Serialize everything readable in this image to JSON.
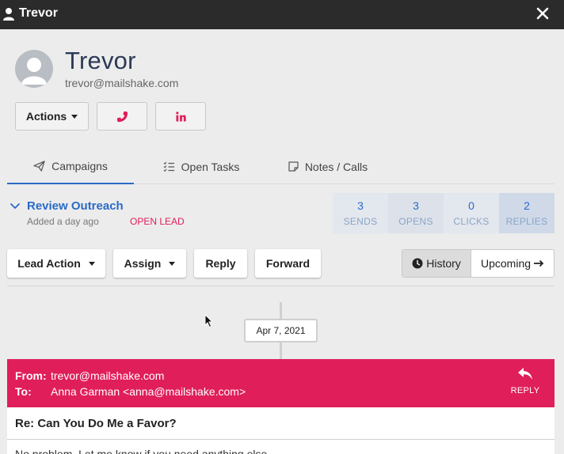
{
  "window": {
    "title": "Trevor"
  },
  "contact": {
    "name": "Trevor",
    "email": "trevor@mailshake.com"
  },
  "actions": {
    "actions_label": "Actions"
  },
  "tabs": [
    {
      "label": "Campaigns",
      "icon": "paper-plane-icon"
    },
    {
      "label": "Open Tasks",
      "icon": "checklist-icon"
    },
    {
      "label": "Notes / Calls",
      "icon": "note-icon"
    }
  ],
  "campaign": {
    "name": "Review Outreach",
    "added": "Added a day ago",
    "status": "OPEN LEAD",
    "stats": [
      {
        "value": "3",
        "label": "SENDS"
      },
      {
        "value": "3",
        "label": "OPENS"
      },
      {
        "value": "0",
        "label": "CLICKS"
      },
      {
        "value": "2",
        "label": "REPLIES"
      }
    ]
  },
  "lead_toolbar": {
    "lead_action": "Lead Action",
    "assign": "Assign",
    "reply": "Reply",
    "forward": "Forward",
    "history": "History",
    "upcoming": "Upcoming"
  },
  "timeline": {
    "date": "Apr 7, 2021"
  },
  "email": {
    "from_label": "From:",
    "from": "trevor@mailshake.com",
    "to_label": "To:",
    "to": "Anna Garman <anna@mailshake.com>",
    "reply_label": "REPLY",
    "subject": "Re: Can You Do Me a Favor?",
    "body": "No problem. Let me know if you need anything else."
  },
  "colors": {
    "accent": "#2a6bc6",
    "brand_pink": "#e01e5a",
    "titlebar": "#2b2b2b"
  }
}
